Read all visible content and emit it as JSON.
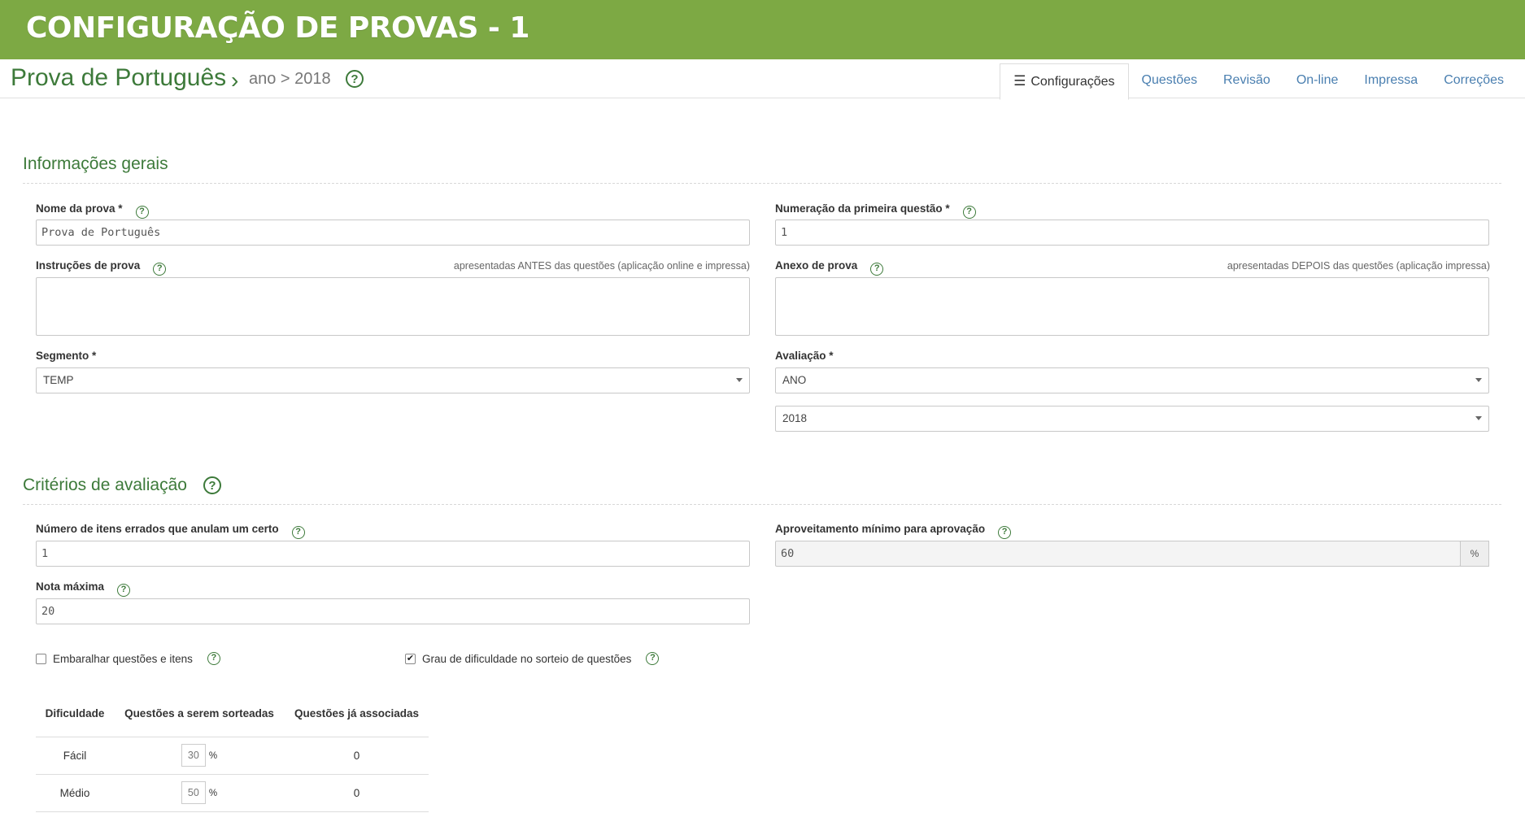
{
  "banner": {
    "title": "CONFIGURAÇÃO DE PROVAS - 1",
    "color": "#7da944"
  },
  "breadcrumb": {
    "title": "Prova de Português",
    "separator": "›",
    "path": "ano > 2018"
  },
  "tabs": [
    {
      "label": "Configurações",
      "icon": "sliders-icon",
      "active": true
    },
    {
      "label": "Questões"
    },
    {
      "label": "Revisão"
    },
    {
      "label": "On-line"
    },
    {
      "label": "Impressa"
    },
    {
      "label": "Correções"
    }
  ],
  "general": {
    "title": "Informações gerais",
    "nome_label": "Nome da prova *",
    "nome_placeholder": "Prova de Português",
    "numeracao_label": "Numeração da primeira questão *",
    "numeracao_value": "1",
    "instrucoes_label": "Instruções de prova",
    "instrucoes_hint": "apresentadas ANTES das questões (aplicação online e impressa)",
    "anexo_label": "Anexo de prova",
    "anexo_hint": "apresentadas DEPOIS das questões (aplicação impressa)",
    "segmento_label": "Segmento *",
    "segmento_value": "TEMP",
    "avaliacao_label": "Avaliação *",
    "avaliacao_value": "ANO",
    "avaliacao_year": "2018"
  },
  "criteria": {
    "title": "Critérios de avaliação",
    "erros_label": "Número de itens errados que anulam um certo",
    "erros_value": "1",
    "aproveitamento_label": "Aproveitamento mínimo para aprovação",
    "aproveitamento_value": "60",
    "aproveitamento_unit": "%",
    "nota_label": "Nota máxima",
    "nota_value": "20",
    "embaralhar_label": "Embaralhar questões e itens",
    "embaralhar_checked": false,
    "grau_label": "Grau de dificuldade no sorteio de questões",
    "grau_checked": true
  },
  "difficulty_table": {
    "headers": [
      "Dificuldade",
      "Questões a serem sorteadas",
      "Questões já associadas"
    ],
    "unit": "%",
    "rows": [
      {
        "level": "Fácil",
        "percent": "30",
        "associated": "0"
      },
      {
        "level": "Médio",
        "percent": "50",
        "associated": "0"
      }
    ]
  },
  "help_glyph": "?",
  "accent_color": "#3d7a3a",
  "link_color": "#4a7fb0"
}
